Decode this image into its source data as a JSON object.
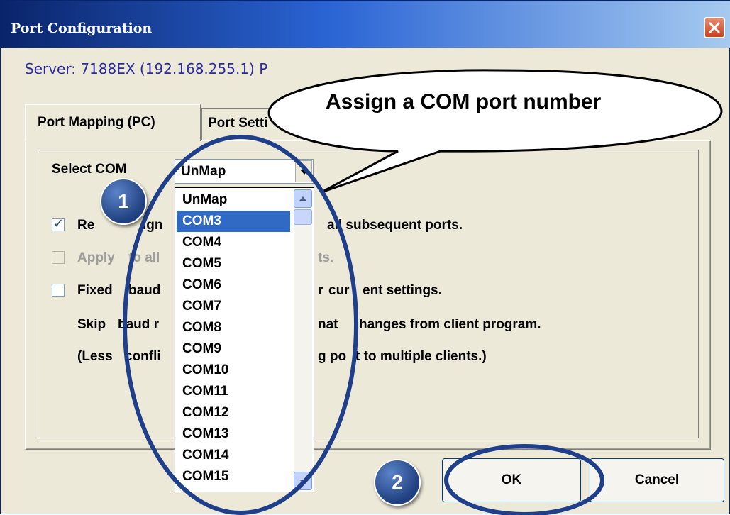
{
  "window": {
    "title": "Port Configuration",
    "server_text": "Server: 7188EX  (192.168.255.1)  P"
  },
  "tabs": [
    {
      "label": "Port Mapping (PC)",
      "active": true
    },
    {
      "label": "Port Setti",
      "active": false
    }
  ],
  "form": {
    "select_com_label": "Select COM",
    "select_com_value": "UnMap",
    "reassign_label_a": "Re",
    "reassign_label_b": "ign",
    "reassign_label_c": "all subsequent ports.",
    "apply_label_a": "Apply",
    "apply_label_b": "to all",
    "apply_label_c": "ts.",
    "fixed_label_a": "Fixed",
    "fixed_label_b": "baud",
    "fixed_label_c": "r",
    "fixed_label_d": "cur",
    "fixed_label_e": "ent settings.",
    "skip_label_a": "Skip",
    "skip_label_b": "baud r",
    "skip_label_c": "nat",
    "skip_label_d": "hanges from client program.",
    "less_label_a": "(Less",
    "less_label_b": "confli",
    "less_label_c": "g po",
    "less_label_d": "t to multiple clients.)"
  },
  "com_options": [
    "UnMap",
    "COM3",
    "COM4",
    "COM5",
    "COM6",
    "COM7",
    "COM8",
    "COM9",
    "COM10",
    "COM11",
    "COM12",
    "COM13",
    "COM14",
    "COM15"
  ],
  "selected_option": "COM3",
  "buttons": {
    "ok": "OK",
    "cancel": "Cancel"
  },
  "annotations": {
    "callout_text": "Assign a COM port number",
    "badge_1": "1",
    "badge_2": "2"
  },
  "colors": {
    "selection": "#316ac5",
    "annotation_ring": "#1f3f8a"
  }
}
